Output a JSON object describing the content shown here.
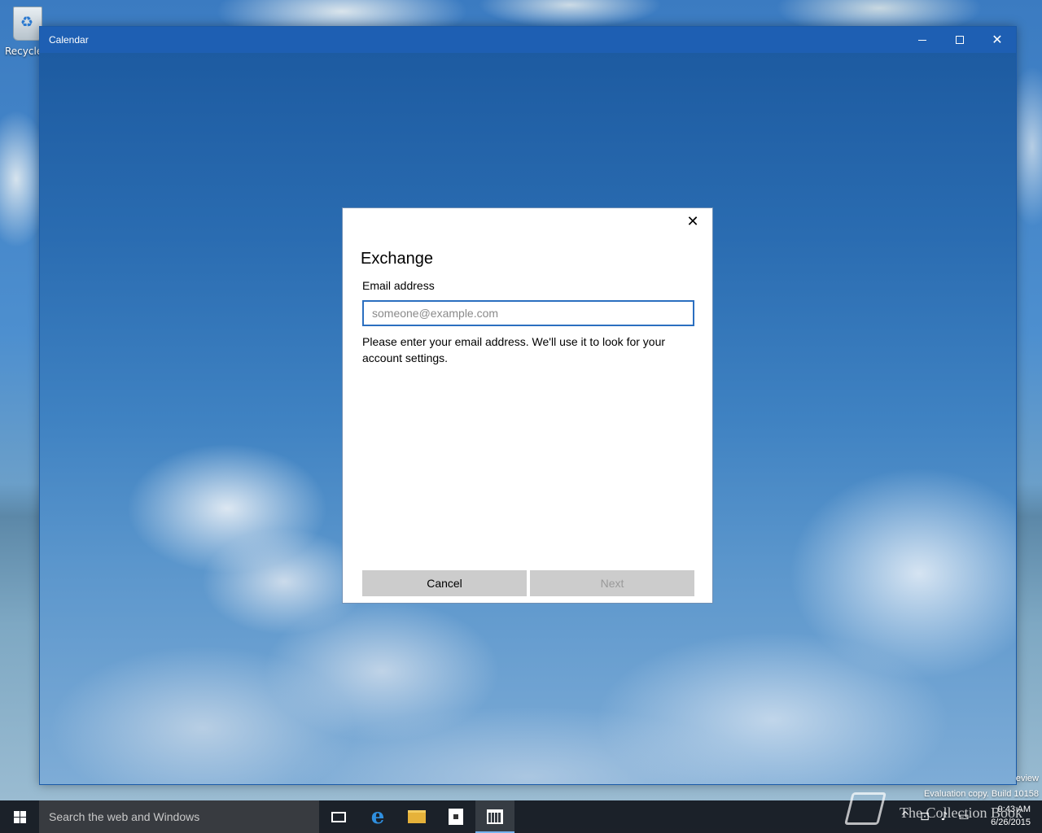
{
  "desktop": {
    "recycle_label": "Recycle",
    "eval_line1": "eview",
    "eval_line2": "Evaluation copy. Build 10158"
  },
  "window": {
    "title": "Calendar"
  },
  "dialog": {
    "title": "Exchange",
    "email_label": "Email address",
    "email_placeholder": "someone@example.com",
    "email_value": "",
    "helper_text": "Please enter your email address. We'll use it to look for your account settings.",
    "cancel_label": "Cancel",
    "next_label": "Next"
  },
  "taskbar": {
    "search_placeholder": "Search the web and Windows",
    "brand_text": "The Collection Book",
    "clock_time": "9:43 AM",
    "clock_date": "6/26/2015"
  }
}
